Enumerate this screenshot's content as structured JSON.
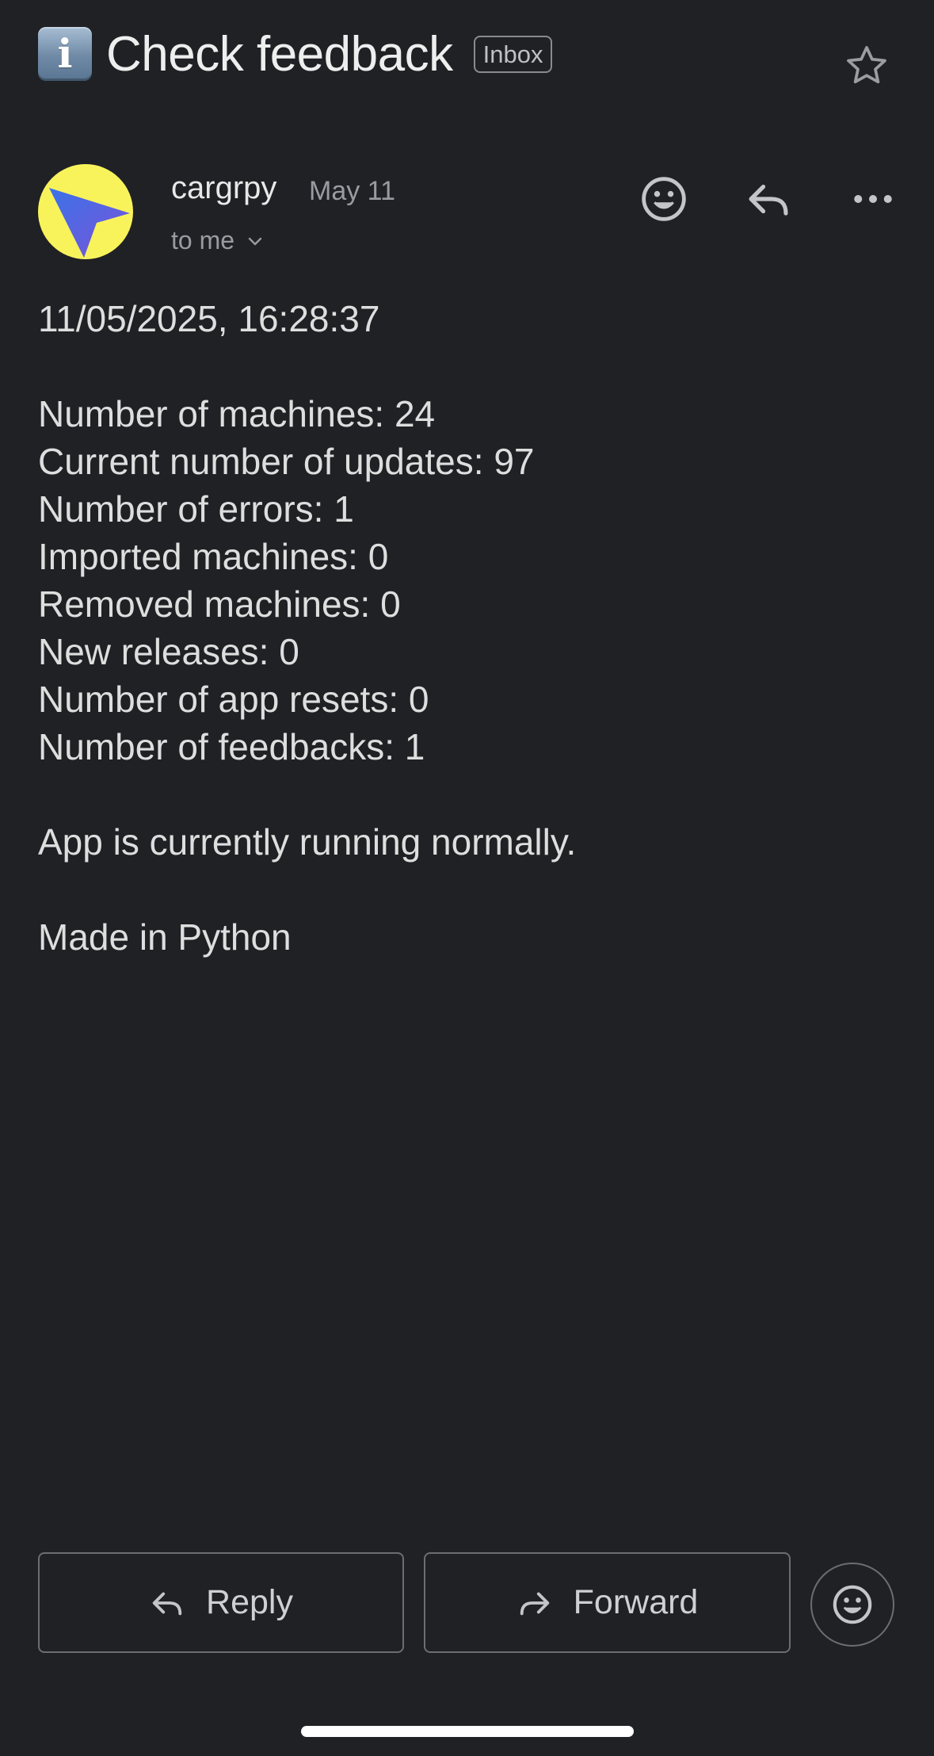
{
  "email": {
    "subject": "Check feedback",
    "subject_emoji": "i",
    "label": "Inbox",
    "sender_name": "cargrpy",
    "date": "May 11",
    "recipient": "to me",
    "body": {
      "timestamp": "11/05/2025, 16:28:37",
      "stats": [
        "Number of machines: 24",
        "Current number of updates: 97",
        "Number of errors: 1",
        "Imported machines: 0",
        "Removed machines: 0",
        "New releases: 0",
        "Number of app resets: 0",
        "Number of feedbacks: 1"
      ],
      "status": "App is currently running normally.",
      "footer": "Made in Python"
    }
  },
  "actions": {
    "reply_label": "Reply",
    "forward_label": "Forward"
  },
  "icons": {
    "info": "info-emoji-icon",
    "star": "star-outline-icon",
    "avatar": "paper-plane-logo",
    "react": "smiley-icon",
    "reply": "reply-arrow-icon",
    "more": "more-horizontal-icon",
    "forward": "forward-arrow-icon",
    "chevron": "chevron-down-icon"
  },
  "colors": {
    "background": "#202125",
    "avatar_bg": "#f8f35b",
    "logo_blue": "#3b73e8",
    "logo_purple": "#7b52d9"
  }
}
